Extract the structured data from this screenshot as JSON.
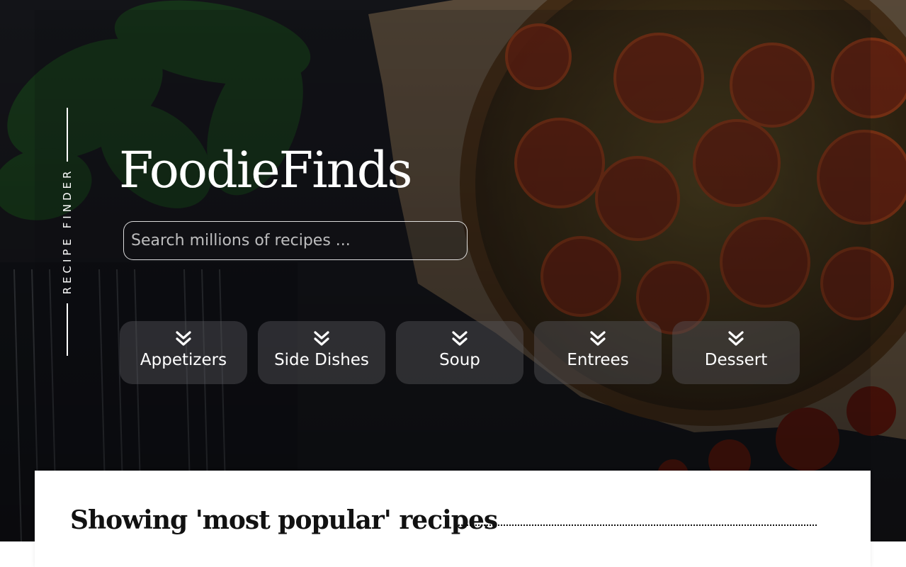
{
  "brand": {
    "side_label": "RECIPE FINDER",
    "title": "FoodieFinds"
  },
  "search": {
    "placeholder": "Search millions of recipes ...",
    "value": ""
  },
  "categories": [
    {
      "label": "Appetizers",
      "icon": "double-chevron-down-icon"
    },
    {
      "label": "Side Dishes",
      "icon": "double-chevron-down-icon"
    },
    {
      "label": "Soup",
      "icon": "double-chevron-down-icon"
    },
    {
      "label": "Entrees",
      "icon": "double-chevron-down-icon"
    },
    {
      "label": "Dessert",
      "icon": "double-chevron-down-icon"
    }
  ],
  "results": {
    "heading": "Showing 'most popular' recipes"
  },
  "colors": {
    "text_light": "#ffffff",
    "text_dark": "#111111",
    "overlay": "#1a1a1f"
  }
}
